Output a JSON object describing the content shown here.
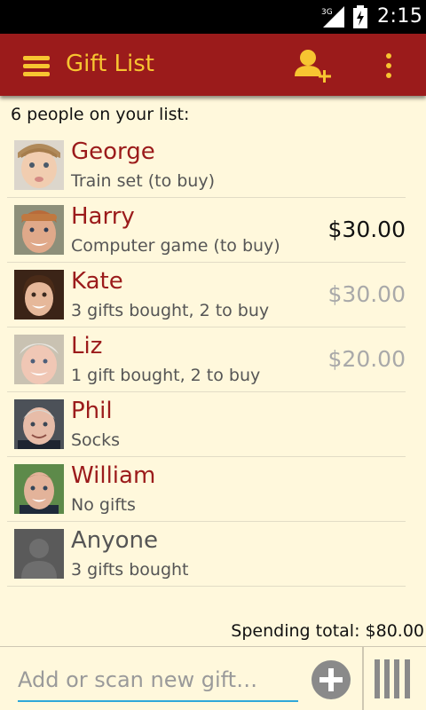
{
  "status_bar": {
    "network": "3G",
    "time": "2:15"
  },
  "app_bar": {
    "title": "Gift List",
    "menu_icon": "hamburger-menu-icon",
    "add_icon": "add-person-icon",
    "overflow_icon": "overflow-menu-icon"
  },
  "summary": "6 people on your list:",
  "people": [
    {
      "name": "George",
      "detail": "Train set (to buy)",
      "amount": ""
    },
    {
      "name": "Harry",
      "detail": "Computer game (to buy)",
      "amount": "$30.00"
    },
    {
      "name": "Kate",
      "detail": "3 gifts bought, 2 to buy",
      "amount": "$30.00"
    },
    {
      "name": "Liz",
      "detail": "1 gift bought, 2 to buy",
      "amount": "$20.00"
    },
    {
      "name": "Phil",
      "detail": "Socks",
      "amount": ""
    },
    {
      "name": "William",
      "detail": "No gifts",
      "amount": ""
    },
    {
      "name": "Anyone",
      "detail": "3 gifts bought",
      "amount": ""
    }
  ],
  "total": "Spending total: $80.00",
  "input": {
    "placeholder": "Add or scan new gift…"
  },
  "colors": {
    "app_bar": "#9b1b1b",
    "accent": "#f7c531",
    "background": "#fff8dc",
    "input_line": "#2fa8d8"
  }
}
